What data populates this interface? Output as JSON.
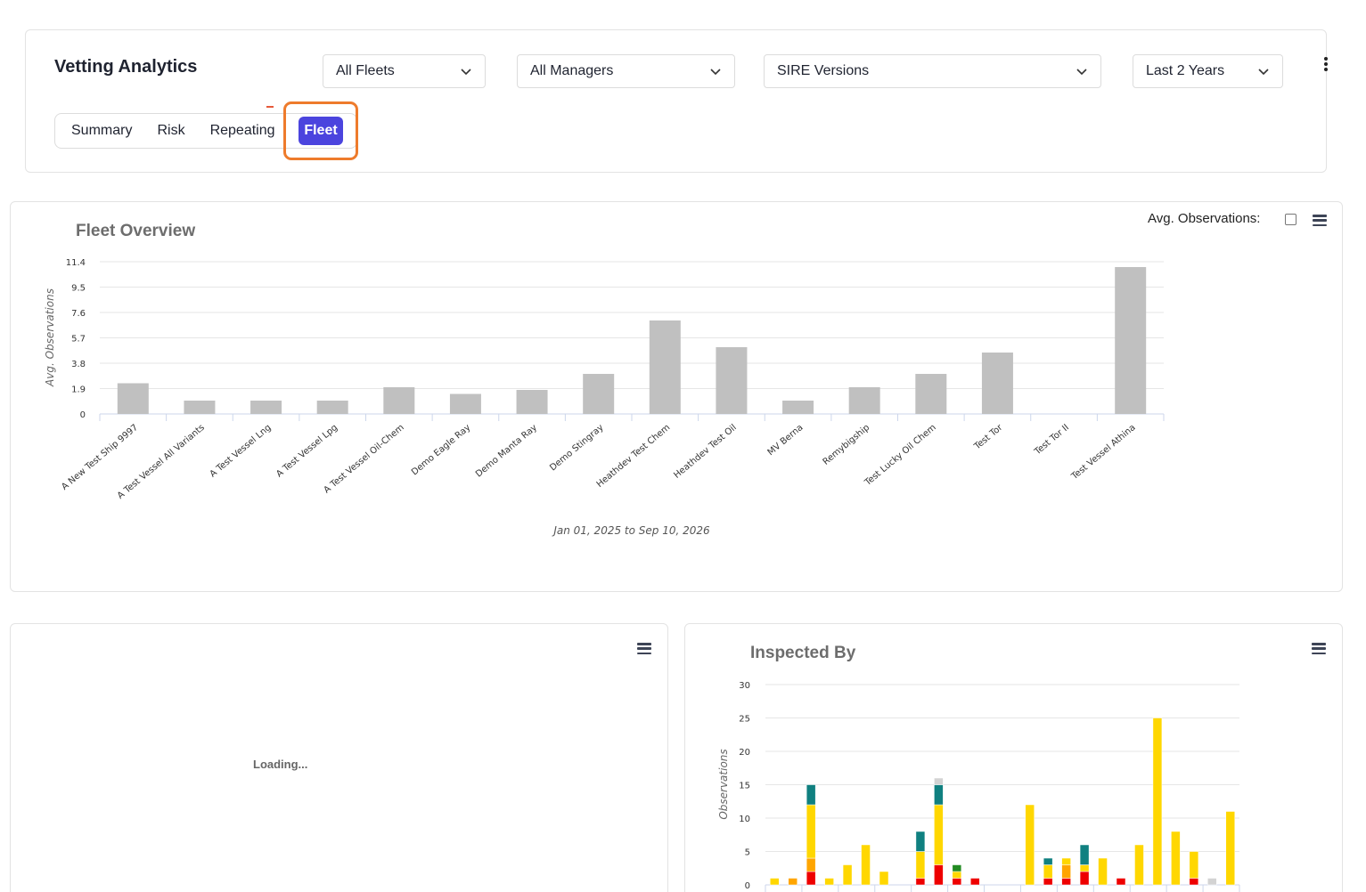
{
  "header": {
    "title": "Vetting Analytics",
    "filters": [
      {
        "value": "All Fleets"
      },
      {
        "value": "All Managers"
      },
      {
        "value": "SIRE Versions"
      },
      {
        "value": "Last 2 Years"
      }
    ],
    "tabs": [
      {
        "label": "Summary"
      },
      {
        "label": "Risk"
      },
      {
        "label": "Repeating"
      },
      {
        "label": "Fleet",
        "active": true
      }
    ]
  },
  "fleet_overview": {
    "avg_label": "Avg. Observations:",
    "avg_checked": false
  },
  "loading_panel": {
    "text": "Loading..."
  },
  "colors": {
    "accent": "#4b44de",
    "highlight": "#ee7b2c",
    "bar_gray": "#c0c0c0",
    "yellow": "#ffd700",
    "teal": "#108080",
    "orange": "#ffa500",
    "red": "#ee0000",
    "green": "#228b22",
    "light_gray": "#d3d3d3"
  },
  "chart_data": [
    {
      "type": "bar",
      "title": "Fleet Overview",
      "ylabel": "Avg. Observations",
      "xlabel": "Jan 01, 2025 to Sep 10, 2026",
      "ylim": [
        0,
        11.4
      ],
      "yticks": [
        "0",
        "1.9",
        "3.8",
        "5.7",
        "7.6",
        "9.5",
        "11.4"
      ],
      "grid": true,
      "categories": [
        "A New Test Ship 9997",
        "A Test Vessel All Variants",
        "A Test Vessel Lng",
        "A Test Vessel Lpg",
        "A Test Vessel Oil-Chem",
        "Demo Eagle Ray",
        "Demo Manta Ray",
        "Demo Stingray",
        "Heathdev Test Chem",
        "Heathdev Test Oil",
        "MV Berna",
        "Remybigship",
        "Test Lucky Oil Chem",
        "Test Tor",
        "Test Tor II",
        "Test Vessel Athina"
      ],
      "values": [
        2.3,
        1.0,
        1.0,
        1.0,
        2.0,
        1.5,
        1.8,
        3.0,
        7.0,
        5.0,
        1.0,
        2.0,
        3.0,
        4.6,
        0,
        11.0
      ]
    },
    {
      "type": "bar",
      "stacked": true,
      "title": "Inspected By",
      "ylabel": "Observations",
      "ylim": [
        0,
        30
      ],
      "yticks": [
        "0",
        "5",
        "10",
        "15",
        "20",
        "25",
        "30"
      ],
      "grid": true,
      "series": [
        {
          "color": "#ee0000",
          "values": [
            0,
            0,
            2,
            0,
            0,
            0,
            0,
            0,
            1,
            3,
            1,
            1,
            0,
            0,
            0,
            1,
            1,
            2,
            0,
            1,
            0,
            0,
            0,
            1,
            0,
            0
          ]
        },
        {
          "color": "#ffa500",
          "values": [
            0,
            1,
            2,
            0,
            0,
            0,
            0,
            0,
            0,
            0,
            0,
            0,
            0,
            0,
            0,
            0,
            2,
            0,
            0,
            0,
            0,
            0,
            0,
            0,
            0,
            0
          ]
        },
        {
          "color": "#ffd700",
          "values": [
            1,
            0,
            8,
            1,
            3,
            6,
            2,
            0,
            4,
            9,
            1,
            0,
            0,
            0,
            12,
            2,
            1,
            1,
            4,
            0,
            6,
            25,
            8,
            4,
            0,
            11
          ]
        },
        {
          "color": "#228b22",
          "values": [
            0,
            0,
            0,
            0,
            0,
            0,
            0,
            0,
            0,
            0,
            1,
            0,
            0,
            0,
            0,
            0,
            0,
            0,
            0,
            0,
            0,
            0,
            0,
            0,
            0,
            0
          ]
        },
        {
          "color": "#108080",
          "values": [
            0,
            0,
            3,
            0,
            0,
            0,
            0,
            0,
            3,
            3,
            0,
            0,
            0,
            0,
            0,
            1,
            0,
            3,
            0,
            0,
            0,
            0,
            0,
            0,
            0,
            0
          ]
        },
        {
          "color": "#d3d3d3",
          "values": [
            0,
            0,
            0,
            0,
            0,
            0,
            0,
            0,
            0,
            1,
            0,
            0,
            0,
            0,
            0,
            0,
            0,
            0,
            0,
            0,
            0,
            0,
            0,
            0,
            1,
            0
          ]
        }
      ]
    }
  ]
}
